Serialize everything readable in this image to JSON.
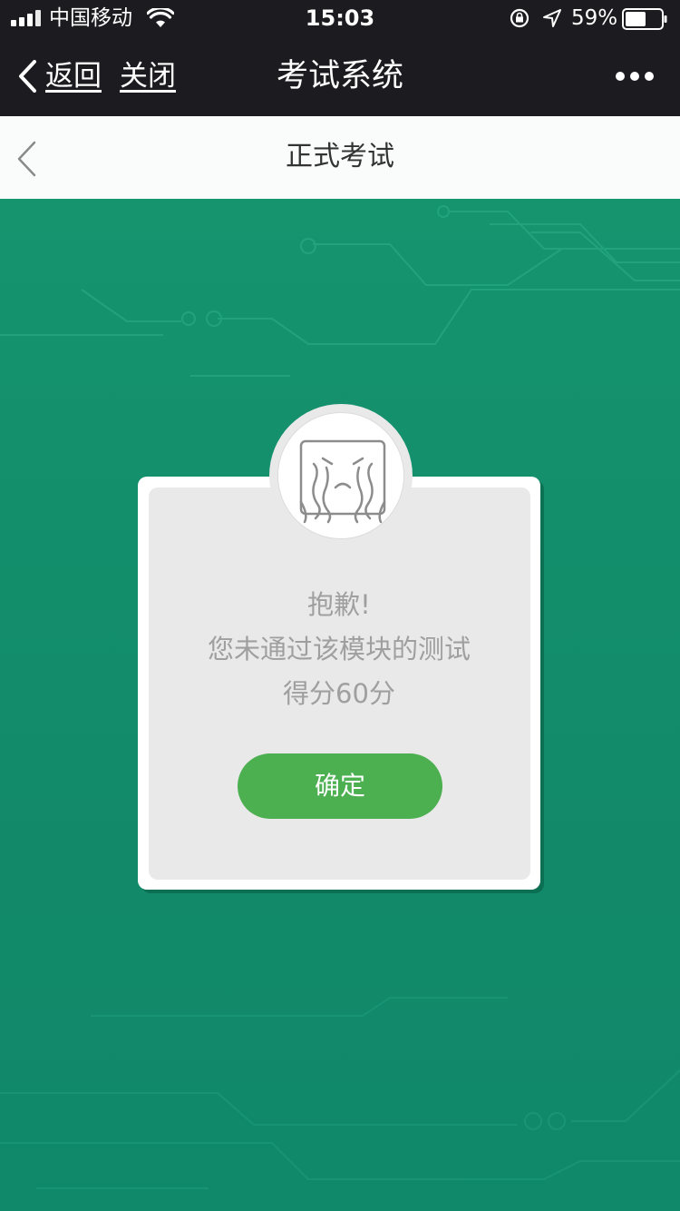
{
  "status_bar": {
    "carrier": "中国移动",
    "time": "15:03",
    "battery_percent": "59%",
    "battery_level": 0.59,
    "icons": [
      "signal-icon",
      "wifi-icon",
      "orientation-lock-icon",
      "location-arrow-icon",
      "battery-icon"
    ]
  },
  "nav": {
    "back_label": "返回",
    "close_label": "关闭",
    "title": "考试系统",
    "more_icon": "more-dots-icon"
  },
  "sub_header": {
    "title": "正式考试",
    "back_icon": "chevron-left-icon"
  },
  "dialog": {
    "icon": "crying-face-icon",
    "line1": "抱歉!",
    "line2": "您未通过该模块的测试",
    "line3": "得分60分",
    "confirm_label": "确定"
  },
  "colors": {
    "background": "#129170",
    "nav_bar": "#1c1b20",
    "confirm_button": "#4caf50",
    "dialog_text": "#9f9f9f"
  }
}
